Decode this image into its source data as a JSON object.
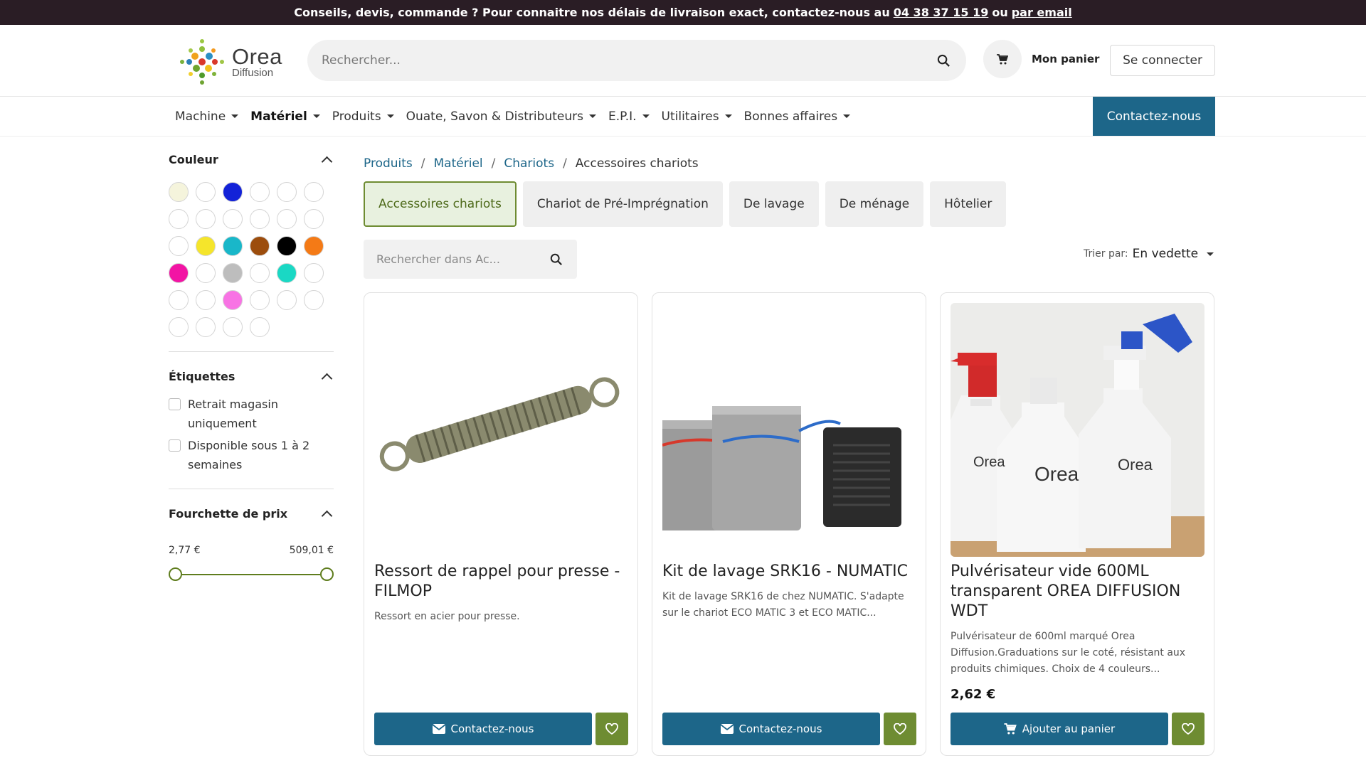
{
  "topbar": {
    "text": "Conseils, devis, commande ? Pour connaitre nos délais de livraison exact, contactez-nous au",
    "phone": "04 38 37 15 19",
    "or": "ou",
    "email_link": "par email"
  },
  "header": {
    "logo_name": "Orea",
    "logo_sub": "Diffusion",
    "search_placeholder": "Rechercher...",
    "cart_label": "Mon panier",
    "login_label": "Se connecter"
  },
  "nav": {
    "items": [
      "Machine",
      "Matériel",
      "Produits",
      "Ouate, Savon & Distributeurs",
      "E.P.I.",
      "Utilitaires",
      "Bonnes affaires"
    ],
    "active": "Matériel",
    "contact_label": "Contactez-nous"
  },
  "sidebar": {
    "color_title": "Couleur",
    "colors": [
      "#f5f4dc",
      "#ffffff",
      "#1322d8",
      "#ffffff",
      "#ffffff",
      "#ffffff",
      "#ffffff",
      "#ffffff",
      "#ffffff",
      "#ffffff",
      "#ffffff",
      "#ffffff",
      "#ffffff",
      "#f5e52b",
      "#19b7c9",
      "#9c4d0d",
      "#000000",
      "#f47a16",
      "#f214a4",
      "#ffffff",
      "#bdbdbd",
      "#ffffff",
      "#1ad8c4",
      "#ffffff",
      "#ffffff",
      "#ffffff",
      "#f873e4",
      "#ffffff",
      "#ffffff",
      "#ffffff",
      "#ffffff",
      "#ffffff",
      "#ffffff",
      "#ffffff"
    ],
    "tags_title": "Étiquettes",
    "tags": [
      "Retrait magasin uniquement",
      "Disponible sous 1 à 2 semaines"
    ],
    "price_title": "Fourchette de prix",
    "price_min": "2,77 €",
    "price_max": "509,01 €"
  },
  "breadcrumb": [
    "Produits",
    "Matériel",
    "Chariots",
    "Accessoires chariots"
  ],
  "categories": [
    "Accessoires chariots",
    "Chariot de Pré-Imprégnation",
    "De lavage",
    "De ménage",
    "Hôtelier"
  ],
  "sub_search_placeholder": "Rechercher dans Ac...",
  "sort": {
    "label": "Trier par:",
    "value": "En vedette"
  },
  "products": [
    {
      "title": "Ressort de rappel pour presse - FILMOP",
      "desc": "Ressort en acier pour presse.",
      "price": "",
      "action": "Contactez-nous"
    },
    {
      "title": "Kit de lavage SRK16 - NUMATIC",
      "desc": "Kit de lavage SRK16 de chez NUMATIC. S'adapte sur le chariot ECO MATIC 3 et ECO MATIC...",
      "price": "",
      "action": "Contactez-nous"
    },
    {
      "title": "Pulvérisateur vide 600ML transparent OREA DIFFUSION WDT",
      "desc": "Pulvérisateur de 600ml marqué Orea Diffusion.Graduations sur le coté, résistant aux produits chimiques. Choix de 4 couleurs...",
      "price": "2,62 €",
      "action": "Ajouter au panier"
    }
  ]
}
